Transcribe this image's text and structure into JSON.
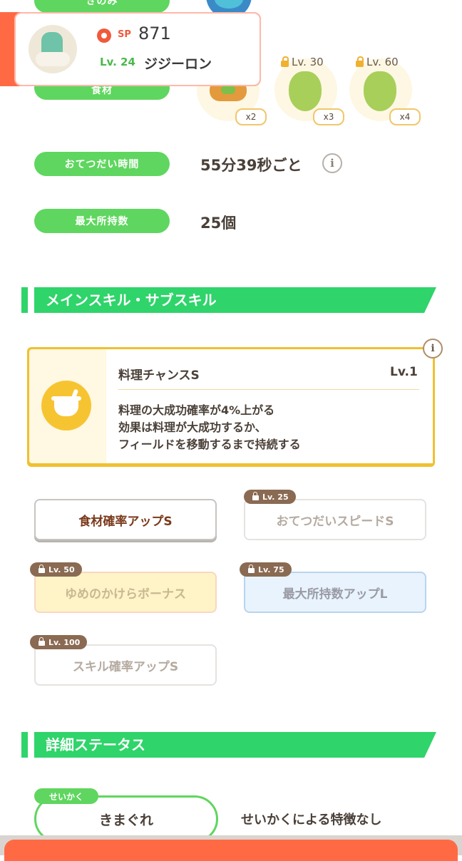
{
  "labels": {
    "berry": "きのみ",
    "ingredients": "食材",
    "help_time": "おてつだい時間",
    "max_carry": "最大所持数"
  },
  "values": {
    "help_time": "55分39秒ごと",
    "max_carry": "25個"
  },
  "pokemon": {
    "sp_label": "SP",
    "sp_value": "871",
    "level": "Lv. 24",
    "name": "ジジーロン"
  },
  "ingredients": [
    {
      "qty": "x2",
      "lock_level": ""
    },
    {
      "qty": "x3",
      "lock_level": "Lv. 30"
    },
    {
      "qty": "x4",
      "lock_level": "Lv. 60"
    }
  ],
  "sections": {
    "skills": "メインスキル・サブスキル",
    "details": "詳細ステータス"
  },
  "main_skill": {
    "name": "料理チャンスS",
    "level": "Lv.1",
    "desc_line1": "料理の大成功確率が4%上がる",
    "desc_line2": "効果は料理が大成功するか、",
    "desc_line3": "フィールドを移動するまで持続する"
  },
  "sub_skills": [
    {
      "label": "食材確率アップS",
      "lock": ""
    },
    {
      "label": "おてつだいスピードS",
      "lock": "Lv. 25"
    },
    {
      "label": "ゆめのかけらボーナス",
      "lock": "Lv. 50"
    },
    {
      "label": "最大所持数アップL",
      "lock": "Lv. 75"
    },
    {
      "label": "スキル確率アップS",
      "lock": "Lv. 100"
    }
  ],
  "nature": {
    "tag": "せいかく",
    "value": "きまぐれ",
    "effect": "せいかくによる特徴なし"
  },
  "colors": {
    "green": "#5fd65f",
    "section_green": "#2fd46a",
    "skill_border": "#f0c030",
    "orange": "#ff6a45"
  },
  "icons": {
    "info": "info-icon",
    "pokeball": "pokeball-icon",
    "lock": "lock-icon",
    "cooking": "cooking-pot-icon"
  }
}
